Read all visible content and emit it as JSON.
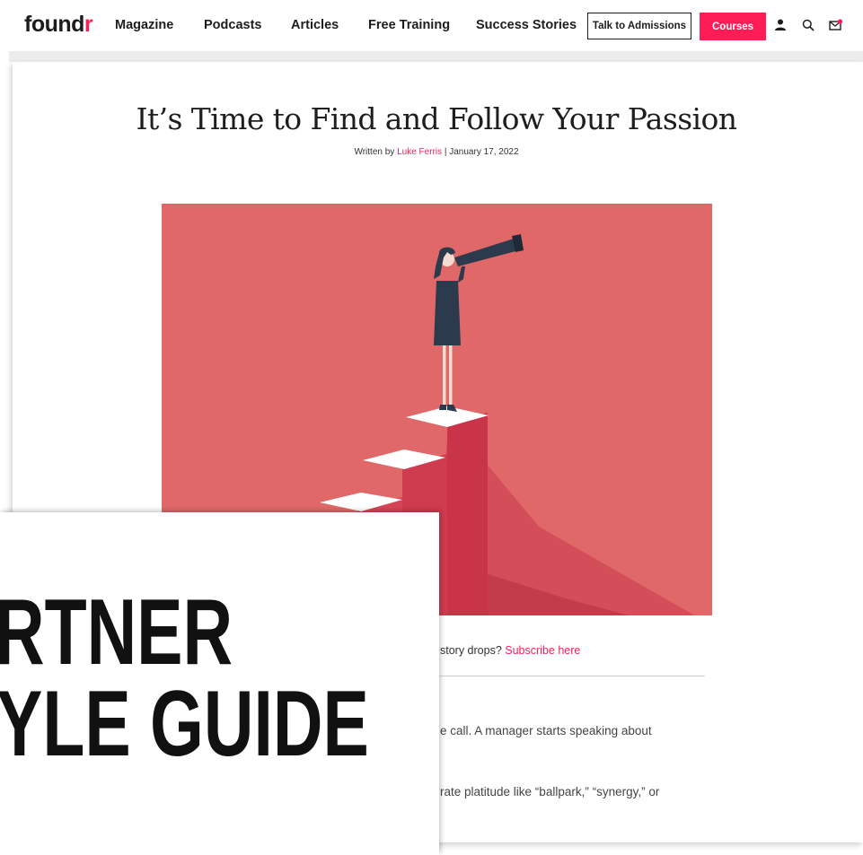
{
  "header": {
    "logo": {
      "text_main": "found",
      "text_accent": "r"
    },
    "nav": [
      {
        "label": "Magazine"
      },
      {
        "label": "Podcasts"
      },
      {
        "label": "Articles"
      },
      {
        "label": "Free Training"
      },
      {
        "label": "Success Stories"
      }
    ],
    "admissions_label": "Talk to Admissions",
    "courses_label": "Courses",
    "icons": [
      "user-icon",
      "search-icon",
      "mail-icon"
    ]
  },
  "article": {
    "title": "It’s Time to Find and Follow Your Passion",
    "byline_prefix": "Written by ",
    "author": "Luke Ferris",
    "byline_suffix": " | January 17, 2022",
    "subscribe_text": "story drops? ",
    "subscribe_link": "Subscribe here",
    "paragraphs": [
      "e call. A manager starts speaking about",
      "rate platitude like “ballpark,” “synergy,” or"
    ]
  },
  "overlay": {
    "line1": "RTNER",
    "line2": "YLE GUIDE"
  },
  "colors": {
    "brand_accent": "#ff1d58",
    "hero_bg": "#e06868",
    "text_dark": "#1d1d1d"
  }
}
